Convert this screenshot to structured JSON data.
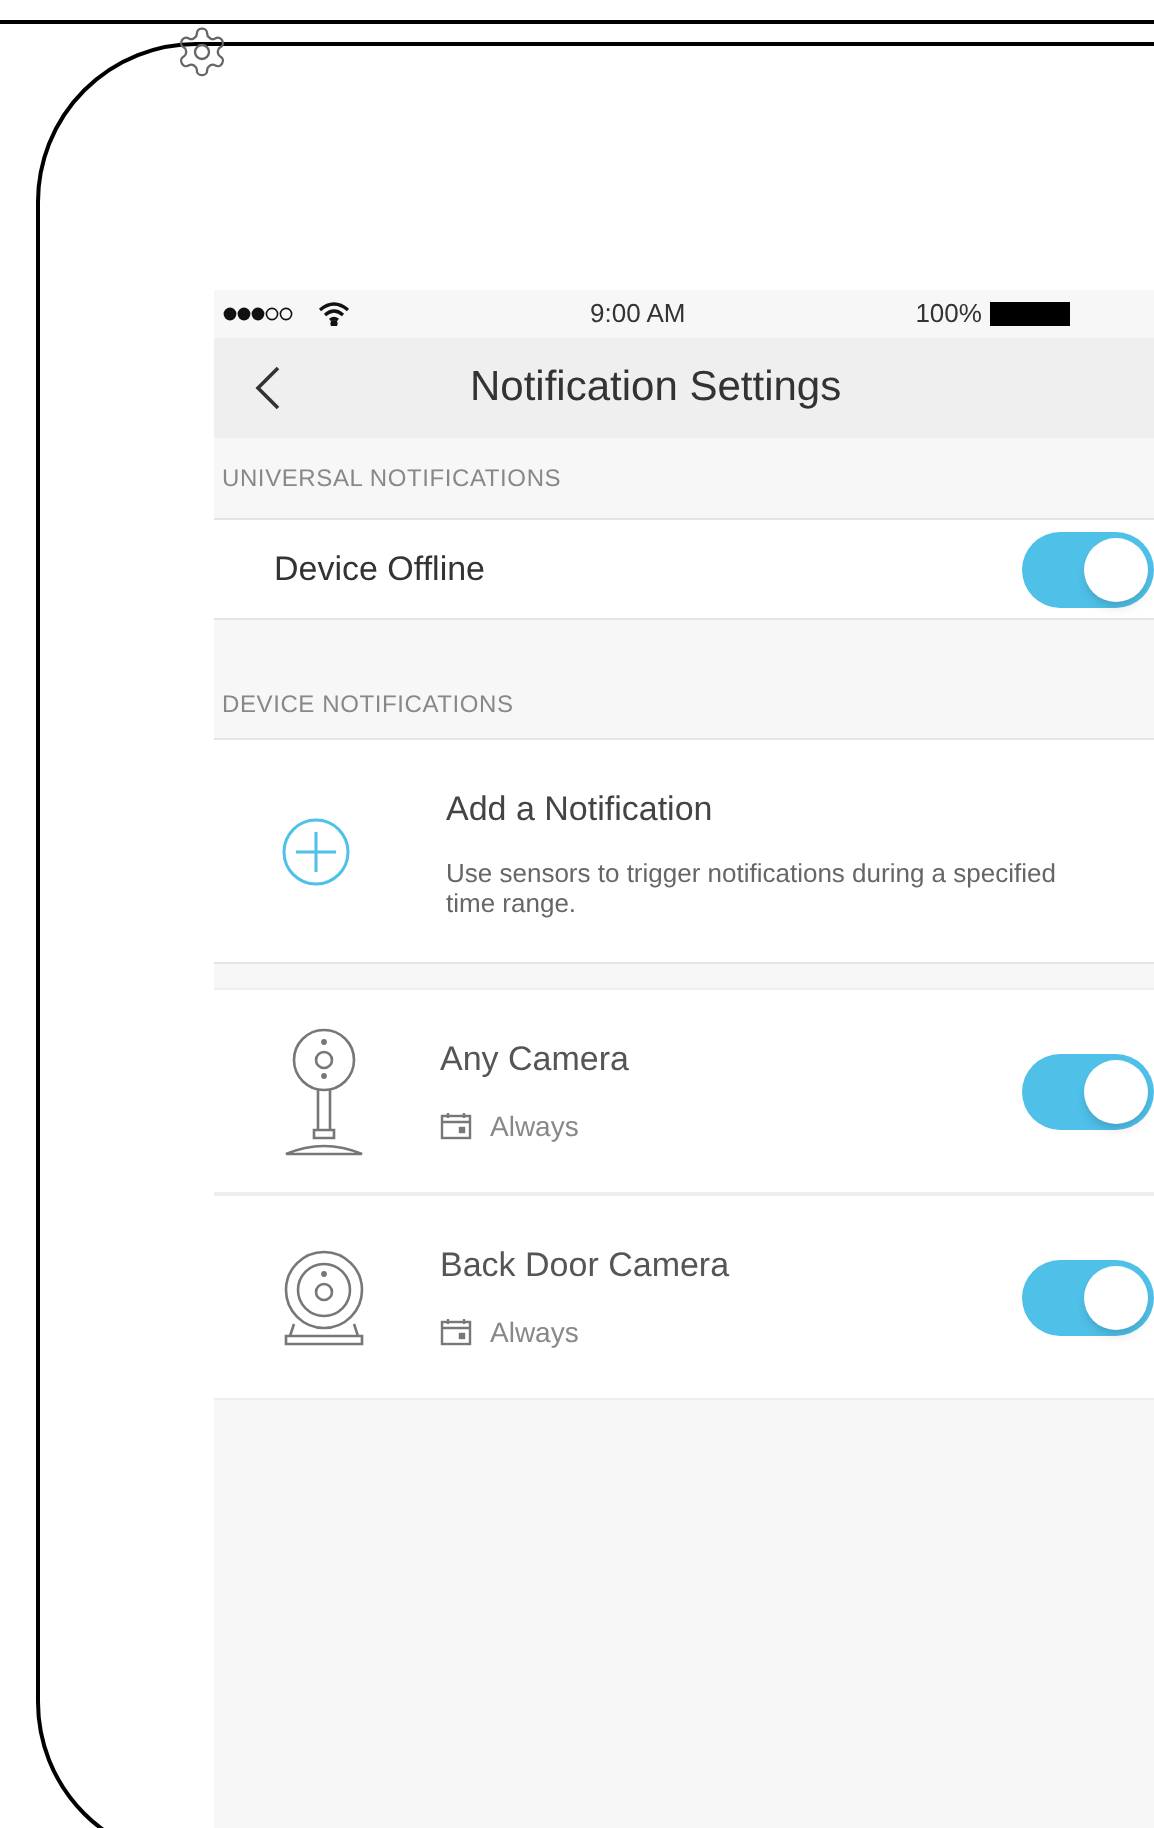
{
  "status_bar": {
    "time": "9:00 AM",
    "battery": "100%"
  },
  "nav": {
    "title": "Notification Settings"
  },
  "universal": {
    "header": "UNIVERSAL NOTIFICATIONS",
    "rows": [
      {
        "label": "Device Offline",
        "on": true
      }
    ]
  },
  "device": {
    "header": "DEVICE NOTIFICATIONS",
    "add": {
      "title": "Add a Notification",
      "description": "Use sensors to trigger notifications during a specified time range."
    },
    "cameras": [
      {
        "kind": "stand",
        "name": "Any Camera",
        "schedule": "Always",
        "on": true
      },
      {
        "kind": "round",
        "name": "Back Door Camera",
        "schedule": "Always",
        "on": true
      }
    ]
  }
}
